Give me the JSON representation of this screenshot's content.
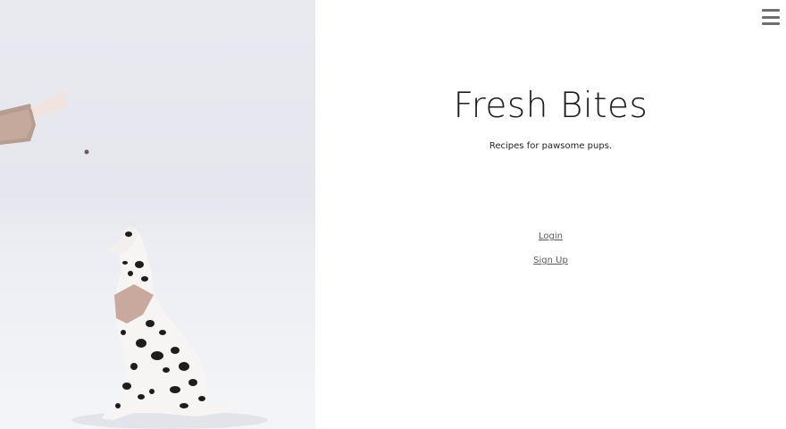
{
  "hero": {
    "image_alt": "Dalmatian dog looking up at a hand holding a treat"
  },
  "header": {
    "menu_icon": "hamburger-menu-icon"
  },
  "main": {
    "title": "Fresh Bites",
    "subtitle": "Recipes for pawsome pups."
  },
  "auth": {
    "login_label": "Login",
    "signup_label": "Sign Up"
  },
  "colors": {
    "text": "#1c1c1c",
    "link": "#5a5a5a",
    "menu": "#6f6f6f",
    "hero_background": "#e8e9ef"
  }
}
